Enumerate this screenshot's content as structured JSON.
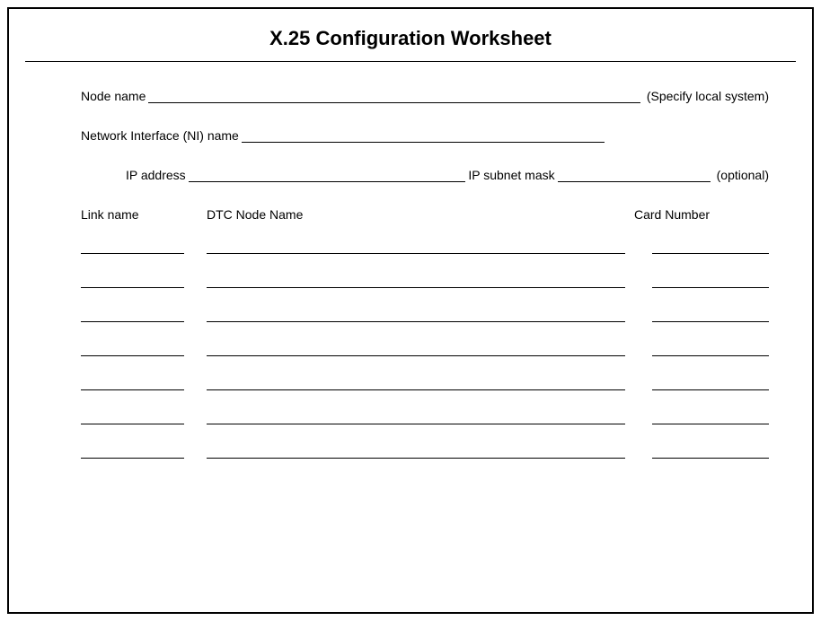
{
  "title": "X.25 Configuration Worksheet",
  "fields": {
    "node_name_label": "Node name",
    "node_name_hint": "(Specify local system)",
    "ni_name_label": "Network Interface (NI) name",
    "ip_address_label": "IP address",
    "ip_subnet_label": "IP subnet mask",
    "ip_hint": "(optional)"
  },
  "columns": {
    "link_name": "Link name",
    "dtc_node_name": "DTC Node Name",
    "card_number": "Card Number"
  },
  "entry_row_count": 7
}
